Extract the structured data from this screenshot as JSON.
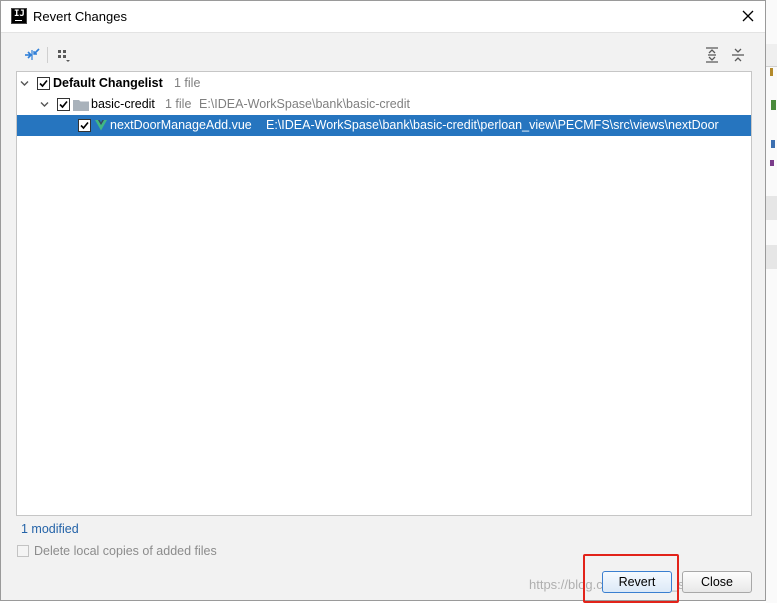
{
  "window": {
    "title": "Revert Changes",
    "app_icon_text": "IJ"
  },
  "tree": {
    "changelist": {
      "name": "Default Changelist",
      "count": "1 file",
      "checked": true
    },
    "module": {
      "name": "basic-credit",
      "count": "1 file",
      "path": "E:\\IDEA-WorkSpase\\bank\\basic-credit",
      "checked": true
    },
    "file": {
      "name": "nextDoorManageAdd.vue",
      "path": "E:\\IDEA-WorkSpase\\bank\\basic-credit\\perloan_view\\PECMFS\\src\\views\\nextDoor",
      "checked": true
    }
  },
  "status": {
    "summary": "1 modified"
  },
  "options": {
    "delete_local_copies": "Delete local copies of added files"
  },
  "buttons": {
    "revert": "Revert",
    "close": "Close"
  },
  "watermark": "https://blog.csdn.net/wjw_so_java",
  "colors": {
    "selection": "#2675bf",
    "status_link": "#2463a8",
    "highlight_box": "#e2231a",
    "vue_green": "#41b883"
  }
}
